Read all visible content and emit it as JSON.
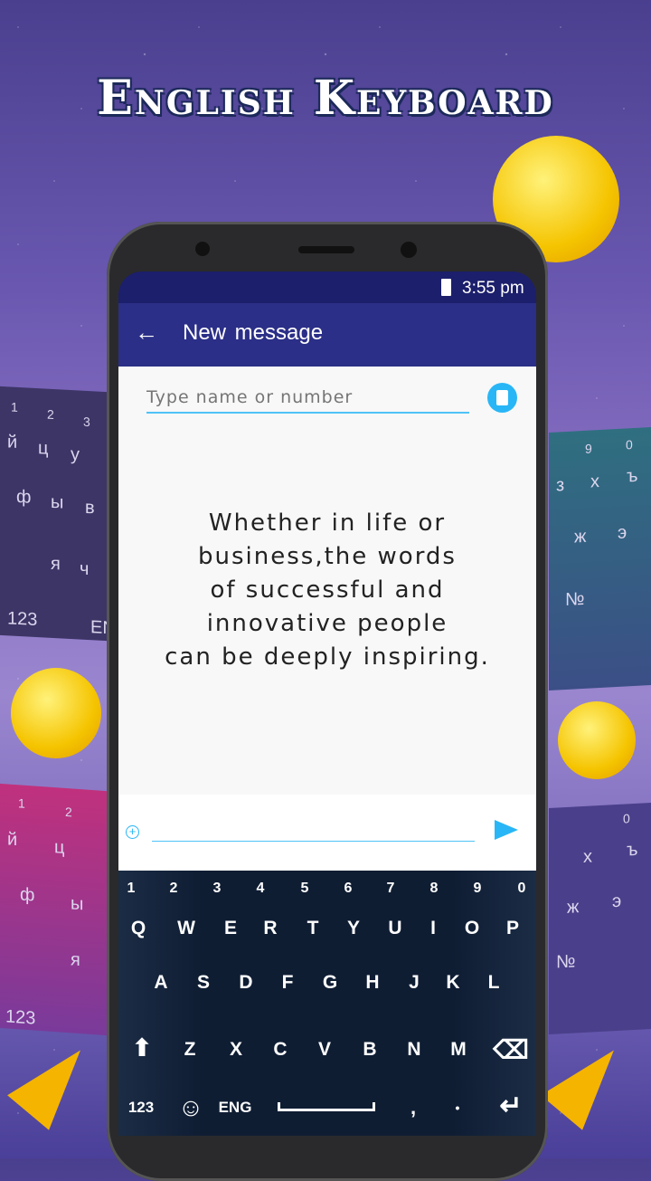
{
  "promo_title": "English Keyboard",
  "status_bar": {
    "time": "3:55 pm",
    "battery_icon": "battery-icon"
  },
  "app_bar": {
    "title": "New message",
    "back_icon": "arrow-left-icon"
  },
  "recipient": {
    "placeholder": "Type name or number",
    "contact_icon": "contact-book-icon"
  },
  "message_text": [
    "Whether in life or",
    "business,the words",
    "of successful and",
    "innovative people",
    "can be deeply inspiring."
  ],
  "compose": {
    "attach_icon": "plus-circle-icon",
    "send_icon": "send-icon",
    "value": ""
  },
  "keyboard": {
    "numbers": [
      "1",
      "2",
      "3",
      "4",
      "5",
      "6",
      "7",
      "8",
      "9",
      "0"
    ],
    "row1": [
      "Q",
      "W",
      "E",
      "R",
      "T",
      "Y",
      "U",
      "I",
      "O",
      "P"
    ],
    "row2": [
      "A",
      "S",
      "D",
      "F",
      "G",
      "H",
      "J",
      "K",
      "L"
    ],
    "row3": [
      "Z",
      "X",
      "C",
      "V",
      "B",
      "N",
      "M"
    ],
    "mode_label": "123",
    "lang_label": "ENG",
    "comma": ",",
    "period": "•"
  },
  "side_keyboards": {
    "left_top": [
      "1",
      "2",
      "3",
      "й",
      "ц",
      "у",
      "ф",
      "ы",
      "в",
      "я",
      "ч",
      "123",
      "EN"
    ],
    "right_top": [
      "9",
      "0",
      "з",
      "х",
      "ъ",
      "ж",
      "э",
      "№"
    ],
    "left_bottom": [
      "1",
      "2",
      "й",
      "ц",
      "ф",
      "ы",
      "я",
      "123"
    ],
    "right_bottom": [
      "0",
      "х",
      "ъ",
      "ж",
      "э",
      "№"
    ]
  },
  "colors": {
    "status_bar": "#1c1f6b",
    "app_bar": "#2b2f87",
    "accent": "#29b6f6",
    "keyboard_bg": "#0f1d33"
  }
}
